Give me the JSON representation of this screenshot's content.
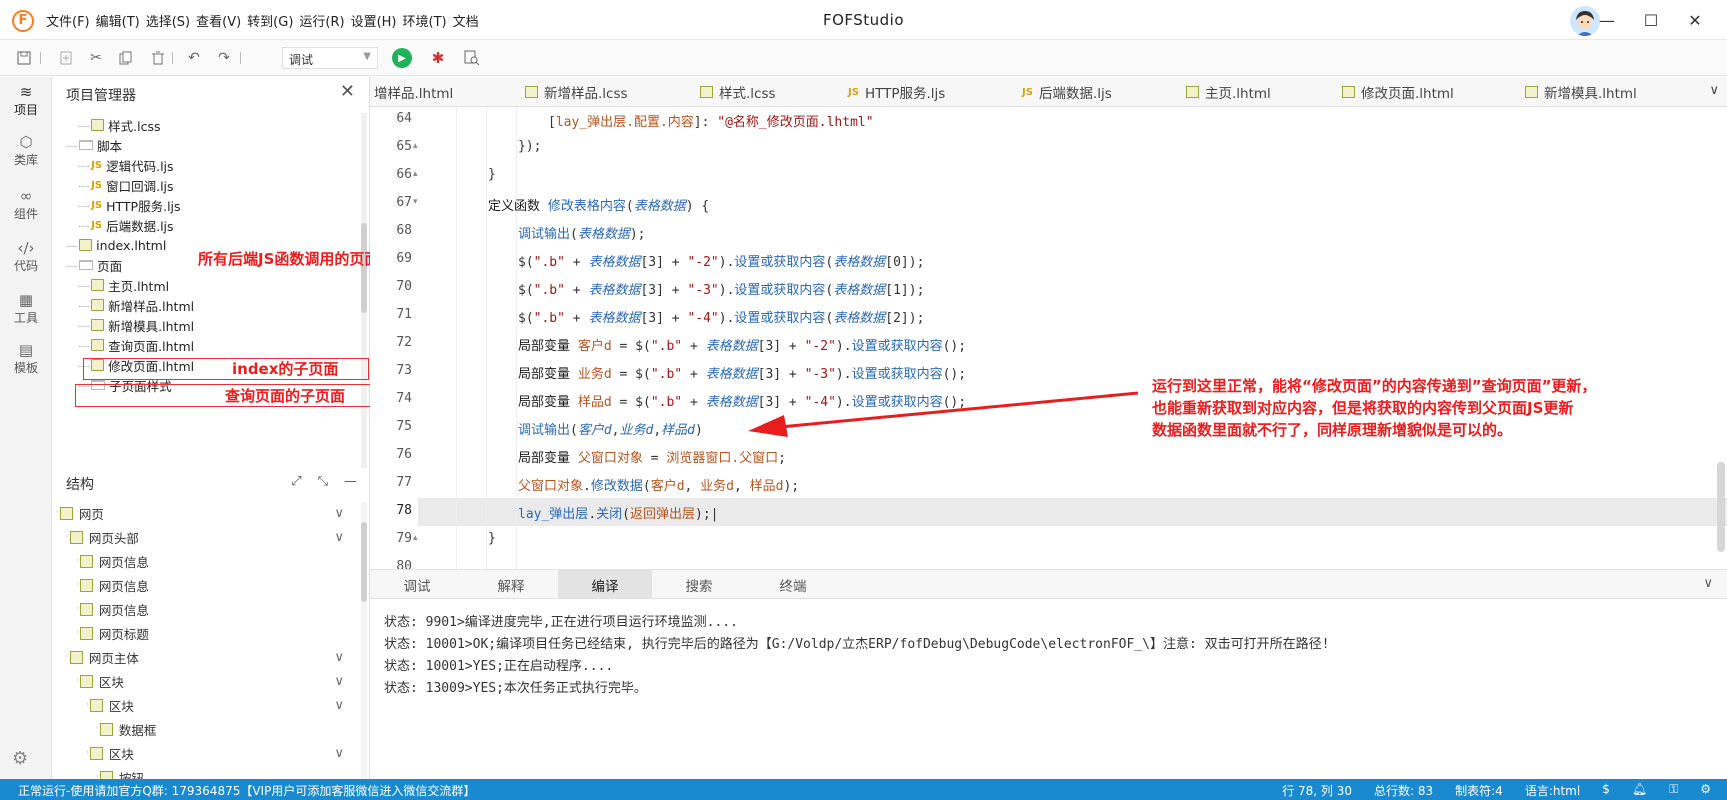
{
  "titlebar": {
    "logo_letter": "F",
    "title": "FOFStudio",
    "menu": [
      "文件(F)",
      "编辑(T)",
      "选择(S)",
      "查看(V)",
      "转到(G)",
      "运行(R)",
      "设置(H)",
      "环境(T)",
      "文档"
    ],
    "controls": [
      "—",
      "☐",
      "✕"
    ]
  },
  "toolbar": {
    "mode": "调试"
  },
  "activity": {
    "items": [
      {
        "label": "项目",
        "icon": "layers-icon"
      },
      {
        "label": "类库",
        "icon": "cube-icon"
      },
      {
        "label": "组件",
        "icon": "link-icon"
      },
      {
        "label": "代码",
        "icon": "code-icon"
      },
      {
        "label": "工具",
        "icon": "tools-icon"
      },
      {
        "label": "模板",
        "icon": "template-icon"
      }
    ]
  },
  "sidebar": {
    "title": "项目管理器",
    "tree": [
      {
        "label": "样式.lcss",
        "type": "file",
        "indent": 2
      },
      {
        "label": "脚本",
        "type": "folder",
        "indent": 1
      },
      {
        "label": "逻辑代码.ljs",
        "type": "js",
        "indent": 2
      },
      {
        "label": "窗口回调.ljs",
        "type": "js",
        "indent": 2
      },
      {
        "label": "HTTP服务.ljs",
        "type": "js",
        "indent": 2
      },
      {
        "label": "后端数据.ljs",
        "type": "js",
        "indent": 2
      },
      {
        "label": "index.lhtml",
        "type": "file",
        "indent": 1
      },
      {
        "label": "页面",
        "type": "folder",
        "indent": 1
      },
      {
        "label": "主页.lhtml",
        "type": "file",
        "indent": 2
      },
      {
        "label": "新增样品.lhtml",
        "type": "file",
        "indent": 2
      },
      {
        "label": "新增模具.lhtml",
        "type": "file",
        "indent": 2
      },
      {
        "label": "查询页面.lhtml",
        "type": "file",
        "indent": 2
      },
      {
        "label": "修改页面.lhtml",
        "type": "file",
        "indent": 2
      },
      {
        "label": "子页面样式",
        "type": "folder",
        "indent": 2
      }
    ],
    "structure_title": "结构",
    "structure": [
      {
        "label": "网页",
        "indent": 0,
        "expandable": true
      },
      {
        "label": "网页头部",
        "indent": 1,
        "expandable": true
      },
      {
        "label": "网页信息",
        "indent": 2,
        "expandable": false
      },
      {
        "label": "网页信息",
        "indent": 2,
        "expandable": false
      },
      {
        "label": "网页信息",
        "indent": 2,
        "expandable": false
      },
      {
        "label": "网页标题",
        "indent": 2,
        "expandable": false
      },
      {
        "label": "网页主体",
        "indent": 1,
        "expandable": true
      },
      {
        "label": "区块",
        "indent": 2,
        "expandable": true
      },
      {
        "label": "区块",
        "indent": 3,
        "expandable": true
      },
      {
        "label": "数据框",
        "indent": 4,
        "expandable": false
      },
      {
        "label": "区块",
        "indent": 3,
        "expandable": true
      },
      {
        "label": "按钮",
        "indent": 4,
        "expandable": false
      }
    ]
  },
  "tabs": [
    {
      "label": "增样品.lhtml",
      "icon": "none"
    },
    {
      "label": "新增样品.lcss",
      "icon": "file"
    },
    {
      "label": "样式.lcss",
      "icon": "file"
    },
    {
      "label": "HTTP服务.ljs",
      "icon": "js"
    },
    {
      "label": "后端数据.ljs",
      "icon": "js"
    },
    {
      "label": "主页.lhtml",
      "icon": "file"
    },
    {
      "label": "修改页面.lhtml",
      "icon": "file"
    },
    {
      "label": "新增模具.lhtml",
      "icon": "file"
    }
  ],
  "editor": {
    "line_numbers": [
      "64",
      "65",
      "66",
      "67",
      "68",
      "69",
      "70",
      "71",
      "72",
      "73",
      "74",
      "75",
      "76",
      "77",
      "78",
      "79",
      "80"
    ],
    "current_line": "78"
  },
  "annotations": {
    "index_callers": "所有后端JS函数调用的页面",
    "index_child": "index的子页面",
    "query_child": "查询页面的子页面",
    "note": [
      "运行到这里正常，能将“修改页面”的内容传递到”查询页面”更新，",
      "也能重新获取到对应内容，但是将获取的内容传到父页面JS更新",
      "数据函数里面就不行了，同样原理新增貌似是可以的。"
    ]
  },
  "panel": {
    "tabs": [
      "调试",
      "解释",
      "编译",
      "搜索",
      "终端"
    ],
    "active": "编译",
    "output": [
      "状态: 9901>编译进度完毕,正在进行项目运行环境监测....",
      "状态: 10001>OK;编译项目任务已经结束, 执行完毕后的路径为【G:/Voldp/立杰ERP/fofDebug\\DebugCode\\electronFOF_\\】注意: 双击可打开所在路径!",
      "状态: 10001>YES;正在启动程序....",
      "状态: 13009>YES;本次任务正式执行完毕。"
    ]
  },
  "status": {
    "left": "正常运行-使用请加官方Q群: 179364875【VIP用户可添加客服微信进入微信交流群】",
    "position": "行 78, 列 30",
    "total": "总行数: 83",
    "tabsize": "制表符:4",
    "language": "语言:html"
  }
}
